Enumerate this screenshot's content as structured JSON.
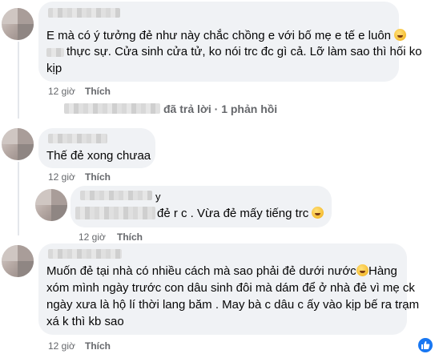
{
  "comments": [
    {
      "lines": [
        "E mà có ý tưởng đẻ như này chắc chồng e với bố mẹ e tế e luôn",
        "thực sự. Cửa sinh cửa tử, ko nói trc đc gì cả. Lỡ làm sao thì hối ko",
        "kịp"
      ],
      "time": "12 giờ",
      "like": "Thích"
    },
    {
      "reply_summary": "đã trả lời · 1 phản hồi"
    },
    {
      "lines": [
        "Thế đẻ xong chưaa"
      ],
      "time": "12 giờ",
      "like": "Thích"
    },
    {
      "lines": [
        "y",
        "đẻ r c . Vừa đẻ mấy tiếng trc"
      ],
      "time": "12 giờ",
      "like": "Thích"
    },
    {
      "lines": [
        "Muốn đẻ tại nhà có nhiều cách mà sao phải đẻ dưới nước",
        "Hàng",
        "xóm mình ngày trước con dâu sinh đôi mà dám để ở nhà đẻ vì mẹ ck",
        "ngày xưa là hộ lí thời lang băm . May bà c dâu c ấy vào kịp bế ra trạm",
        "xá k thì kb sao"
      ],
      "time": "12 giờ",
      "like": "Thích"
    }
  ],
  "colors": {
    "bubble": "#f0f2f5",
    "meta": "#65676b",
    "like_reaction": "#1877f2"
  },
  "icons": [
    "laughing-emoji-icon",
    "grimace-emoji-icon",
    "like-reaction-icon"
  ]
}
